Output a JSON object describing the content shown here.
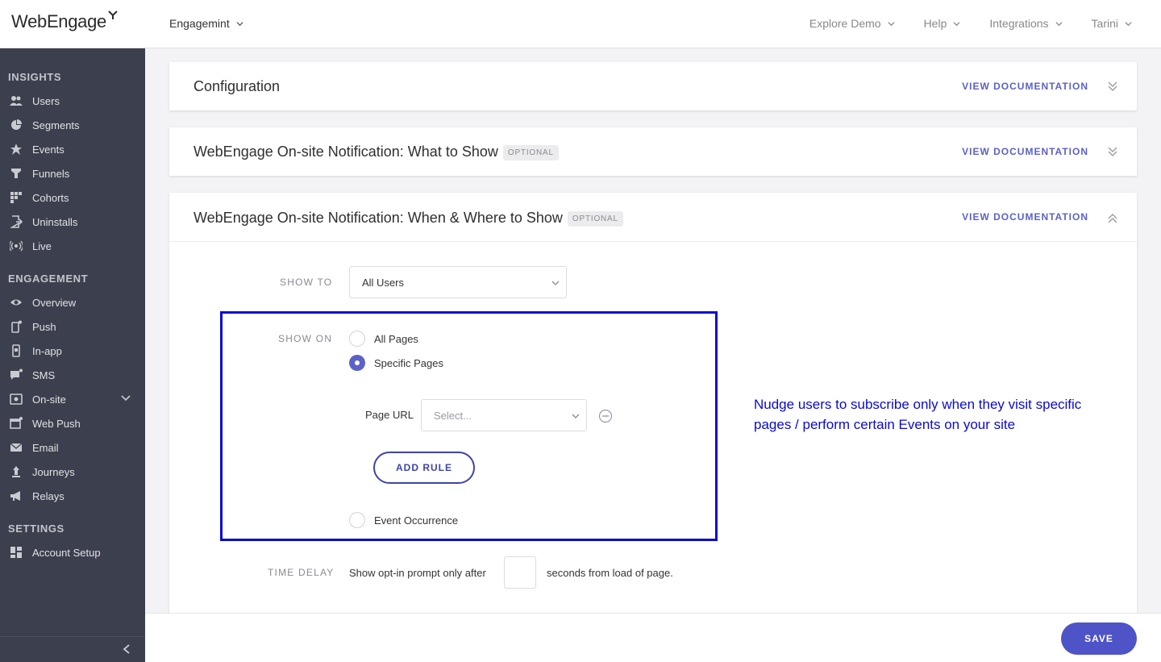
{
  "app": {
    "logo_text": "WebEngage",
    "project": "Engagemint"
  },
  "topnav": [
    {
      "label": "Explore Demo"
    },
    {
      "label": "Help"
    },
    {
      "label": "Integrations"
    },
    {
      "label": "Tarini"
    }
  ],
  "sidebar": {
    "insights": {
      "title": "INSIGHTS",
      "items": [
        {
          "label": "Users",
          "icon": "users-icon"
        },
        {
          "label": "Segments",
          "icon": "pie-chart-icon"
        },
        {
          "label": "Events",
          "icon": "star-burst-icon"
        },
        {
          "label": "Funnels",
          "icon": "funnel-icon"
        },
        {
          "label": "Cohorts",
          "icon": "grid-icon"
        },
        {
          "label": "Uninstalls",
          "icon": "exit-icon"
        },
        {
          "label": "Live",
          "icon": "broadcast-icon"
        }
      ]
    },
    "engagement": {
      "title": "ENGAGEMENT",
      "items": [
        {
          "label": "Overview",
          "icon": "eye-icon"
        },
        {
          "label": "Push",
          "icon": "mobile-push-icon"
        },
        {
          "label": "In-app",
          "icon": "in-app-icon"
        },
        {
          "label": "SMS",
          "icon": "sms-icon"
        },
        {
          "label": "On-site",
          "icon": "on-site-icon"
        },
        {
          "label": "Web Push",
          "icon": "web-push-icon"
        },
        {
          "label": "Email",
          "icon": "email-icon"
        },
        {
          "label": "Journeys",
          "icon": "journeys-icon"
        },
        {
          "label": "Relays",
          "icon": "megaphone-icon"
        }
      ]
    },
    "settings": {
      "title": "SETTINGS",
      "items": [
        {
          "label": "Account Setup",
          "icon": "dashboard-icon"
        }
      ]
    }
  },
  "cards": {
    "config": {
      "title": "Configuration",
      "doc": "VIEW DOCUMENTATION"
    },
    "what": {
      "title": "WebEngage On-site Notification: What to Show",
      "badge": "OPTIONAL",
      "doc": "VIEW DOCUMENTATION"
    },
    "when": {
      "title": "WebEngage On-site Notification: When & Where to Show",
      "badge": "OPTIONAL",
      "doc": "VIEW DOCUMENTATION"
    }
  },
  "form": {
    "show_to": {
      "label": "SHOW TO",
      "value": "All Users"
    },
    "show_on": {
      "label": "SHOW ON",
      "options": [
        "All Pages",
        "Specific Pages",
        "Event Occurrence"
      ],
      "selected": "Specific Pages"
    },
    "page_url": {
      "label": "Page URL",
      "placeholder": "Select..."
    },
    "add_rule": "ADD RULE",
    "time_delay": {
      "label": "TIME DELAY",
      "before": "Show opt-in prompt only after",
      "value": "",
      "after": "seconds from load of page."
    }
  },
  "annotation": "Nudge users to subscribe only when they visit specific pages / perform certain Events on your site",
  "footer": {
    "save": "SAVE"
  },
  "colors": {
    "accent": "#5b62c7",
    "sidebar_bg": "#3c3f4d",
    "annotation": "#0a0ad2"
  }
}
